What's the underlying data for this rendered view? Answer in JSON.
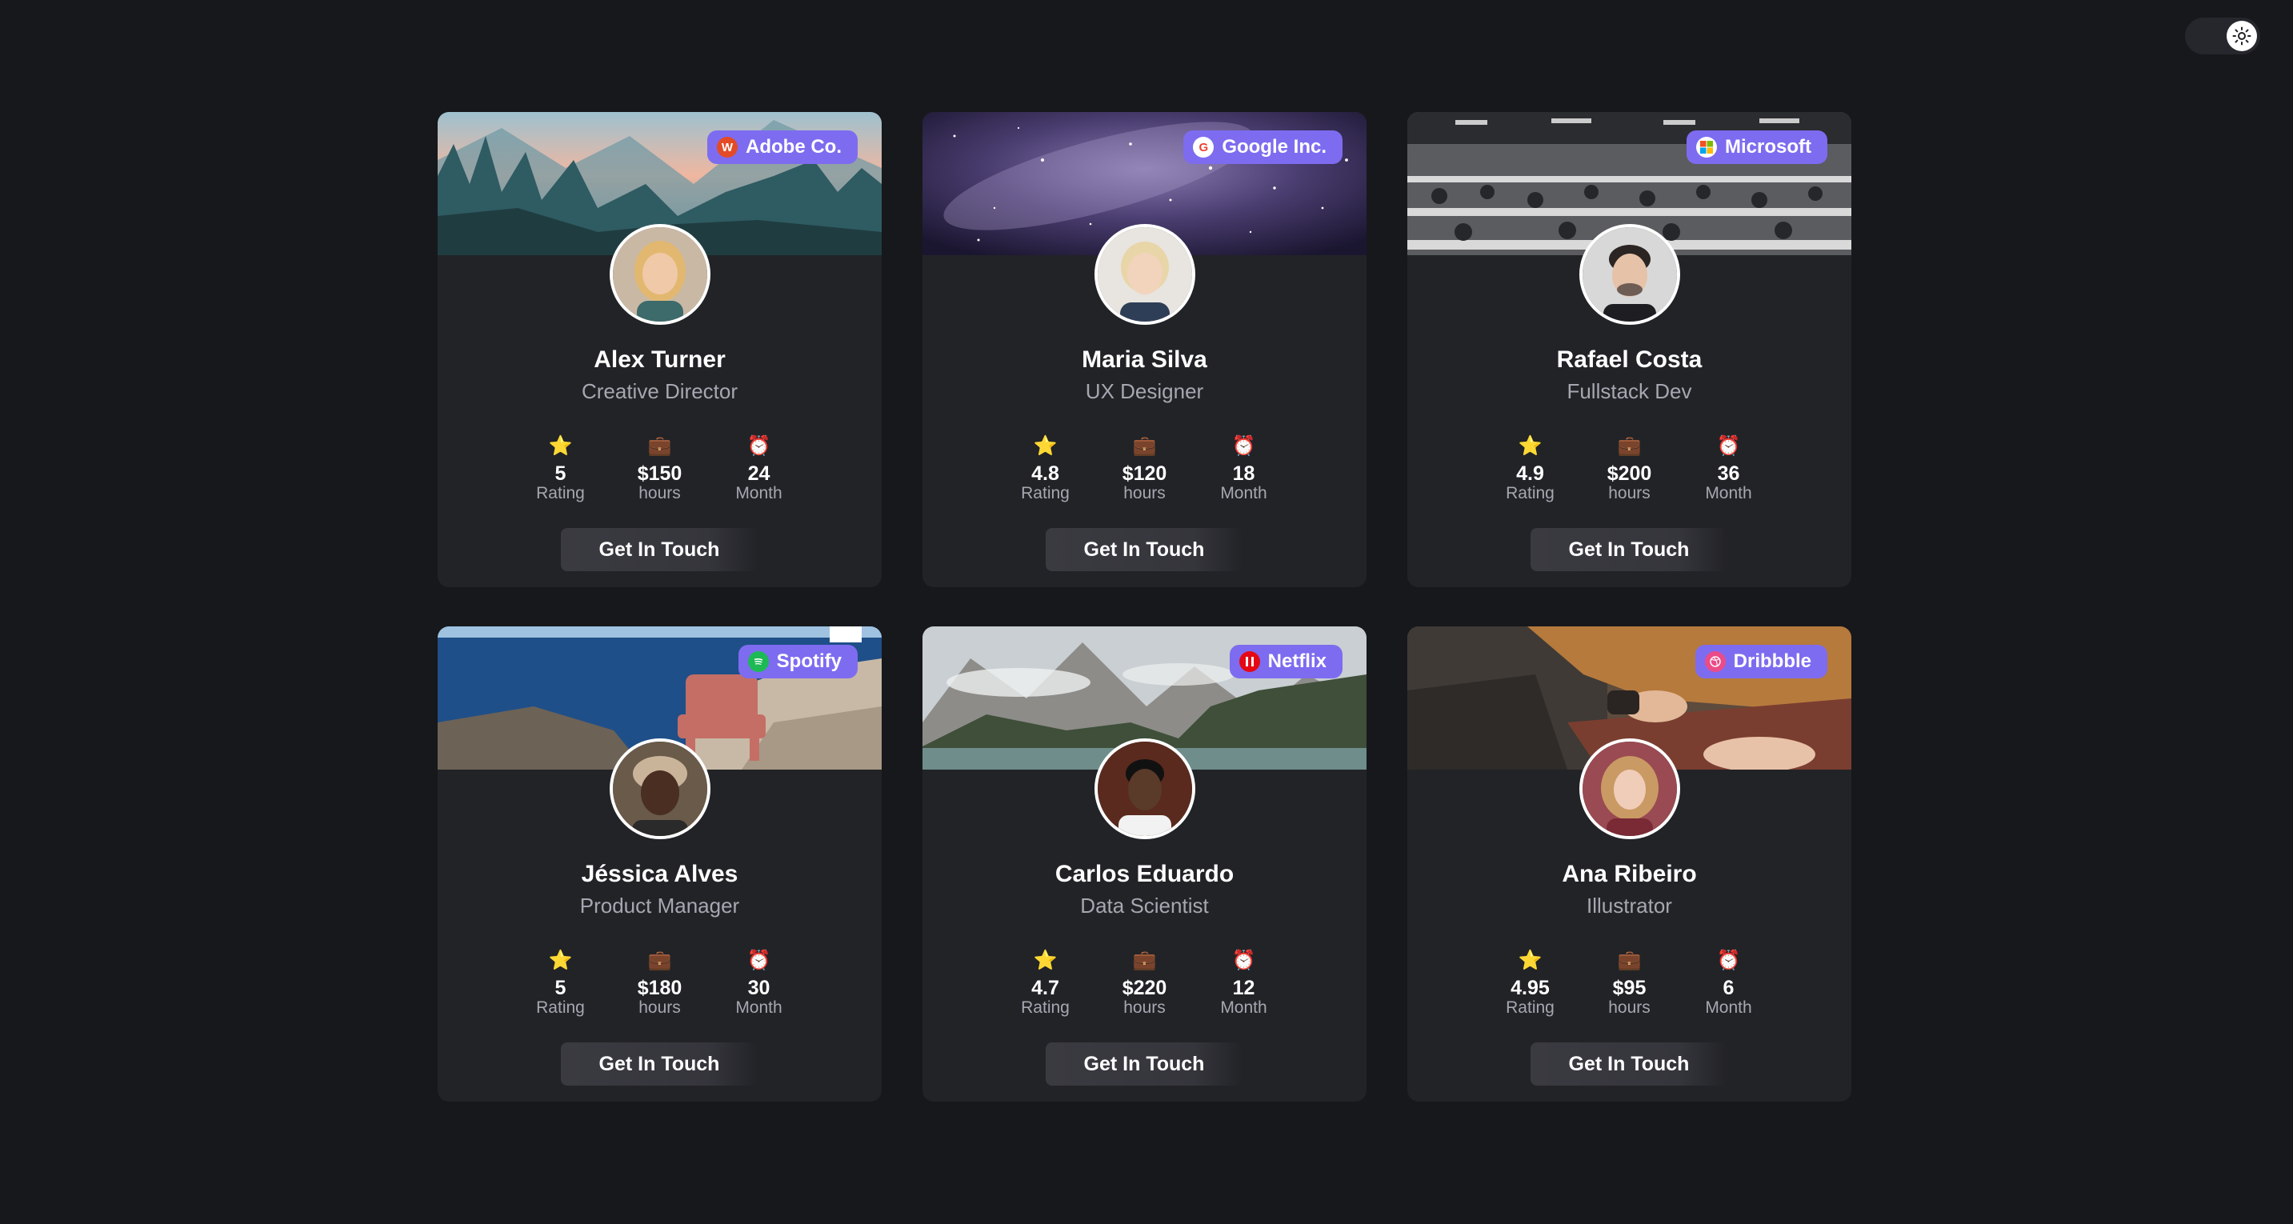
{
  "colors": {
    "background": "#17181c",
    "card": "#222327",
    "badge": "#7d6cf0",
    "muted": "#a6a7b1"
  },
  "theme_toggle": {
    "icon": "sun-icon"
  },
  "stat_icons": {
    "rating": "star-icon",
    "rate": "briefcase-icon",
    "duration": "alarm-clock-icon"
  },
  "cards": [
    {
      "company": "Adobe Co.",
      "company_icon": "adobe-logo-icon",
      "name": "Alex Turner",
      "role": "Creative Director",
      "rating": "5",
      "rating_label": "Rating",
      "rate": "$150",
      "rate_label": "hours",
      "duration": "24",
      "duration_label": "Month",
      "button": "Get In Touch",
      "banner": "forest-mountains-banner"
    },
    {
      "company": "Google Inc.",
      "company_icon": "google-logo-icon",
      "name": "Maria Silva",
      "role": "UX Designer",
      "rating": "4.8",
      "rating_label": "Rating",
      "rate": "$120",
      "rate_label": "hours",
      "duration": "18",
      "duration_label": "Month",
      "button": "Get In Touch",
      "banner": "galaxy-banner"
    },
    {
      "company": "Microsoft",
      "company_icon": "microsoft-logo-icon",
      "name": "Rafael Costa",
      "role": "Fullstack Dev",
      "rating": "4.9",
      "rating_label": "Rating",
      "rate": "$200",
      "rate_label": "hours",
      "duration": "36",
      "duration_label": "Month",
      "button": "Get In Touch",
      "banner": "office-banner"
    },
    {
      "company": "Spotify",
      "company_icon": "spotify-logo-icon",
      "name": "Jéssica Alves",
      "role": "Product Manager",
      "rating": "5",
      "rating_label": "Rating",
      "rate": "$180",
      "rate_label": "hours",
      "duration": "30",
      "duration_label": "Month",
      "button": "Get In Touch",
      "banner": "sea-chair-banner"
    },
    {
      "company": "Netflix",
      "company_icon": "netflix-logo-icon",
      "name": "Carlos Eduardo",
      "role": "Data Scientist",
      "rating": "4.7",
      "rating_label": "Rating",
      "rate": "$220",
      "rate_label": "hours",
      "duration": "12",
      "duration_label": "Month",
      "button": "Get In Touch",
      "banner": "lake-mountains-banner"
    },
    {
      "company": "Dribbble",
      "company_icon": "dribbble-logo-icon",
      "name": "Ana Ribeiro",
      "role": "Illustrator",
      "rating": "4.95",
      "rating_label": "Rating",
      "rate": "$95",
      "rate_label": "hours",
      "duration": "6",
      "duration_label": "Month",
      "button": "Get In Touch",
      "banner": "typing-laptop-banner"
    }
  ]
}
